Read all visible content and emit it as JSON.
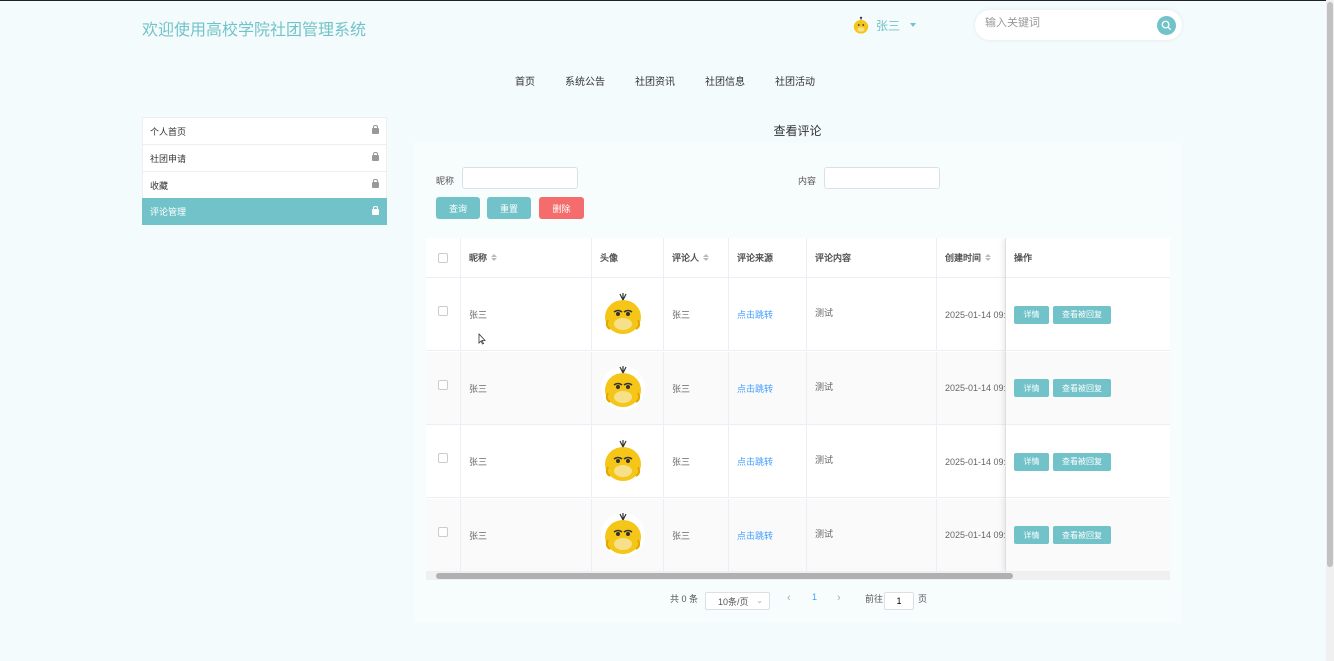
{
  "header": {
    "site_title": "欢迎使用高校学院社团管理系统",
    "username": "张三",
    "search_placeholder": "输入关键词"
  },
  "nav": [
    "首页",
    "系统公告",
    "社团资讯",
    "社团信息",
    "社团活动"
  ],
  "sidebar": {
    "items": [
      {
        "label": "个人首页",
        "active": false
      },
      {
        "label": "社团申请",
        "active": false
      },
      {
        "label": "收藏",
        "active": false
      },
      {
        "label": "评论管理",
        "active": true
      }
    ]
  },
  "main": {
    "title": "查看评论",
    "filters": {
      "nickname_label": "昵称",
      "content_label": "内容",
      "nickname_value": "",
      "content_value": ""
    },
    "buttons": {
      "query": "查询",
      "reset": "重置",
      "delete": "删除"
    }
  },
  "table": {
    "columns": [
      "昵称",
      "头像",
      "评论人",
      "评论来源",
      "评论内容",
      "创建时间",
      "操作"
    ],
    "rows": [
      {
        "nickname": "张三",
        "commenter": "张三",
        "source": "点击跳转",
        "content": "测试",
        "created": "2025-01-14 09:",
        "actions": [
          "详情",
          "查看被回复"
        ]
      },
      {
        "nickname": "张三",
        "commenter": "张三",
        "source": "点击跳转",
        "content": "测试",
        "created": "2025-01-14 09:",
        "actions": [
          "详情",
          "查看被回复"
        ]
      },
      {
        "nickname": "张三",
        "commenter": "张三",
        "source": "点击跳转",
        "content": "测试",
        "created": "2025-01-14 09:",
        "actions": [
          "详情",
          "查看被回复"
        ]
      },
      {
        "nickname": "张三",
        "commenter": "张三",
        "source": "点击跳转",
        "content": "测试",
        "created": "2025-01-14 09:",
        "actions": [
          "详情",
          "查看被回复"
        ]
      }
    ]
  },
  "pagination": {
    "total": "共 0 条",
    "page_size": "10条/页",
    "current_page": "1",
    "goto_label": "前往",
    "goto_value": "1",
    "page_suffix": "页"
  },
  "colors": {
    "accent": "#72c3c9",
    "danger": "#f56c6c",
    "link": "#409eff"
  }
}
